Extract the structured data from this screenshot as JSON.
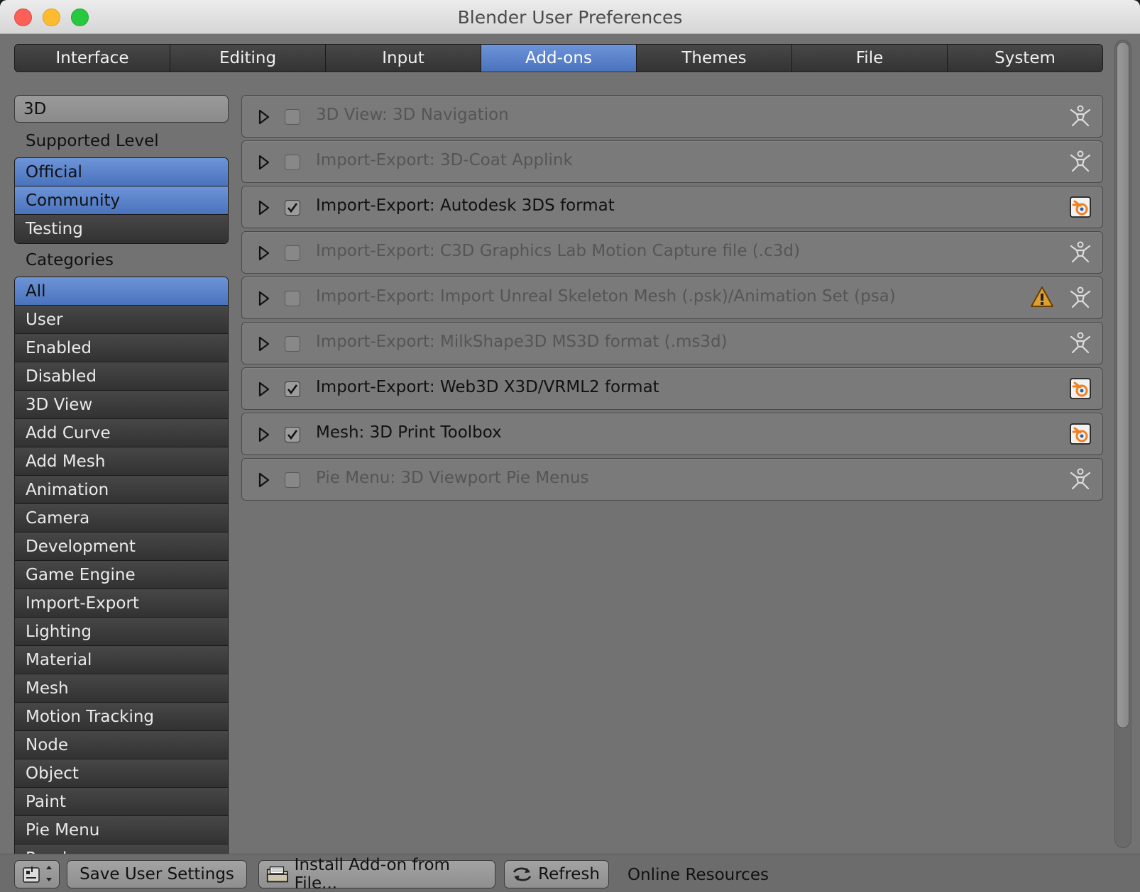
{
  "window": {
    "title": "Blender User Preferences"
  },
  "tabs": [
    {
      "label": "Interface",
      "active": false
    },
    {
      "label": "Editing",
      "active": false
    },
    {
      "label": "Input",
      "active": false
    },
    {
      "label": "Add-ons",
      "active": true
    },
    {
      "label": "Themes",
      "active": false
    },
    {
      "label": "File",
      "active": false
    },
    {
      "label": "System",
      "active": false
    }
  ],
  "sidebar": {
    "search": {
      "value": "3D"
    },
    "supported_level_label": "Supported Level",
    "supported_levels": [
      {
        "label": "Official",
        "selected": true
      },
      {
        "label": "Community",
        "selected": true
      },
      {
        "label": "Testing",
        "selected": false
      }
    ],
    "categories_label": "Categories",
    "categories": [
      {
        "label": "All",
        "selected": true
      },
      {
        "label": "User"
      },
      {
        "label": "Enabled"
      },
      {
        "label": "Disabled"
      },
      {
        "label": "3D View"
      },
      {
        "label": "Add Curve"
      },
      {
        "label": "Add Mesh"
      },
      {
        "label": "Animation"
      },
      {
        "label": "Camera"
      },
      {
        "label": "Development"
      },
      {
        "label": "Game Engine"
      },
      {
        "label": "Import-Export"
      },
      {
        "label": "Lighting"
      },
      {
        "label": "Material"
      },
      {
        "label": "Mesh"
      },
      {
        "label": "Motion Tracking"
      },
      {
        "label": "Node"
      },
      {
        "label": "Object"
      },
      {
        "label": "Paint"
      },
      {
        "label": "Pie Menu"
      },
      {
        "label": "Render"
      }
    ]
  },
  "addons": [
    {
      "name": "3D View: 3D Navigation",
      "enabled": false,
      "support": "community-icon",
      "warning": false
    },
    {
      "name": "Import-Export: 3D-Coat Applink",
      "enabled": false,
      "support": "community-icon",
      "warning": false
    },
    {
      "name": "Import-Export: Autodesk 3DS format",
      "enabled": true,
      "support": "blender-official-icon",
      "warning": false
    },
    {
      "name": "Import-Export: C3D Graphics Lab Motion Capture file (.c3d)",
      "enabled": false,
      "support": "community-icon",
      "warning": false
    },
    {
      "name": "Import-Export: Import Unreal Skeleton Mesh (.psk)/Animation Set (psa)",
      "enabled": false,
      "support": "community-icon",
      "warning": true
    },
    {
      "name": "Import-Export: MilkShape3D MS3D format (.ms3d)",
      "enabled": false,
      "support": "community-icon",
      "warning": false
    },
    {
      "name": "Import-Export: Web3D X3D/VRML2 format",
      "enabled": true,
      "support": "blender-official-icon",
      "warning": false
    },
    {
      "name": "Mesh: 3D Print Toolbox",
      "enabled": true,
      "support": "blender-official-icon",
      "warning": false
    },
    {
      "name": "Pie Menu: 3D Viewport Pie Menus",
      "enabled": false,
      "support": "community-icon",
      "warning": false
    }
  ],
  "bottom": {
    "save_label": "Save User Settings",
    "install_label": "Install Add-on from File...",
    "refresh_label": "Refresh",
    "online_label": "Online Resources"
  },
  "colors": {
    "accent": "#5a82c8",
    "panel": "#727272",
    "button_dark": "#3c3c3c",
    "warning": "#e0a030",
    "official_orange": "#f08020"
  }
}
